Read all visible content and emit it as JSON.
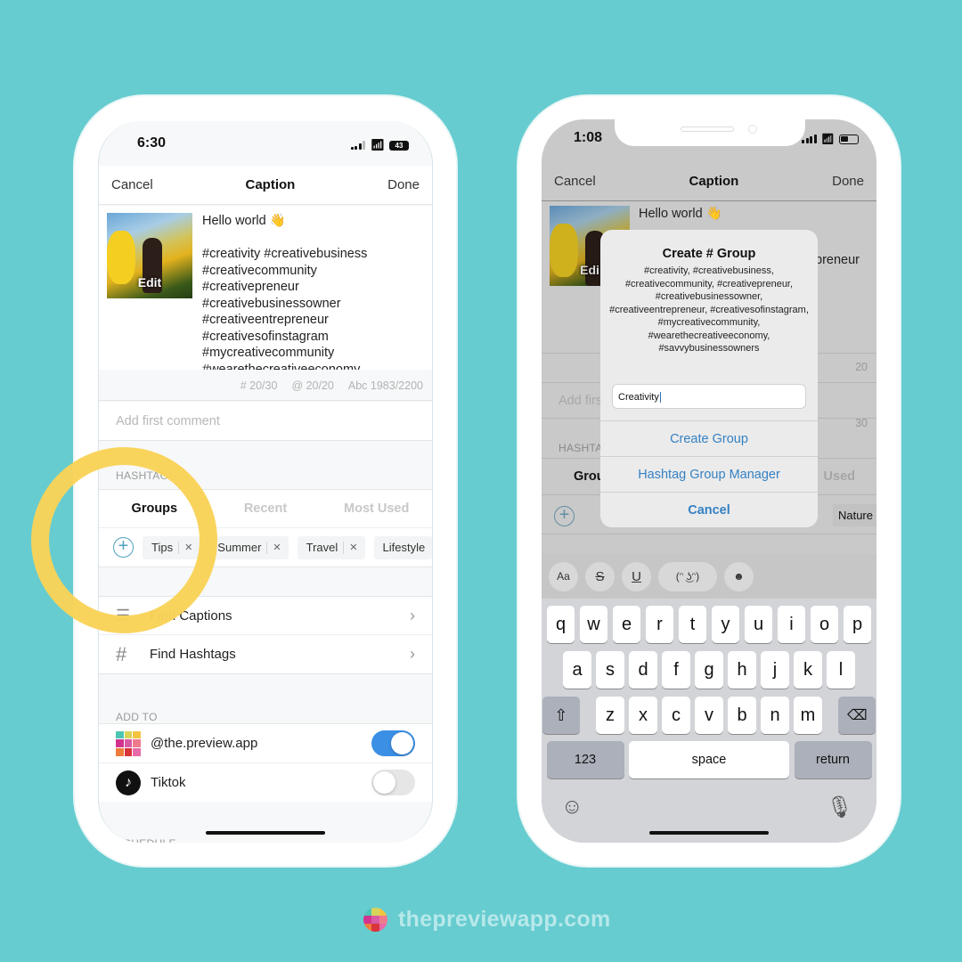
{
  "left_phone": {
    "status": {
      "time": "6:30",
      "battery": "43"
    },
    "nav": {
      "cancel": "Cancel",
      "title": "Caption",
      "done": "Done"
    },
    "post": {
      "thumb_label": "Edit",
      "caption": "Hello world 👋\n\n#creativity #creativebusiness\n#creativecommunity\n#creativepreneur\n#creativebusinessowner\n#creativeentrepreneur\n#creativesofinstagram\n#mycreativecommunity\n#wearethecreativeeconomy"
    },
    "counts": {
      "hashtags": "# 20/30",
      "mentions": "@ 20/20",
      "chars": "Abc 1983/2200"
    },
    "comment_placeholder": "Add first comment",
    "hashtags_section": "HASHTAGS",
    "tabs": [
      {
        "label": "Groups",
        "active": true
      },
      {
        "label": "Recent",
        "active": false
      },
      {
        "label": "Most Used",
        "active": false
      }
    ],
    "chips": [
      "Tips",
      "Summer",
      "Travel",
      "Lifestyle"
    ],
    "menu": [
      {
        "icon": "lines-icon",
        "label": "Find Captions"
      },
      {
        "icon": "hash-icon",
        "label": "Find Hashtags"
      }
    ],
    "add_to_section": "ADD TO",
    "accounts": [
      {
        "label": "@the.preview.app",
        "enabled": true
      },
      {
        "label": "Tiktok",
        "enabled": false
      }
    ],
    "schedule_section": "SCHEDULE"
  },
  "right_phone": {
    "status": {
      "time": "1:08"
    },
    "nav": {
      "cancel": "Cancel",
      "title": "Caption",
      "done": "Done"
    },
    "bg": {
      "caption_first": "Hello world 👋",
      "caption_partial": "preneur",
      "thumb_label": "Edi",
      "count_a": "20",
      "count_b": "30",
      "comment_partial": "Add firs",
      "hashtags_partial": "HASHTA",
      "tab_partial_left": "Grou",
      "tab_partial_right": "Used",
      "chip_partial": "Nature"
    },
    "dialog": {
      "title": "Create # Group",
      "message": "#creativity, #creativebusiness, #creativecommunity, #creativepreneur, #creativebusinessowner, #creativeentrepreneur, #creativesofinstagram, #mycreativecommunity, #wearethecreativeeconomy, #savvybusinessowners",
      "input_value": "Creativity",
      "buttons": [
        "Create Group",
        "Hashtag Group Manager",
        "Cancel"
      ]
    },
    "keyboard": {
      "toolbar": [
        "Aa",
        "S",
        "U",
        "(ᵔ ͜ʖᵔ)",
        "☻"
      ],
      "row1": [
        "q",
        "w",
        "e",
        "r",
        "t",
        "y",
        "u",
        "i",
        "o",
        "p"
      ],
      "row2": [
        "a",
        "s",
        "d",
        "f",
        "g",
        "h",
        "j",
        "k",
        "l"
      ],
      "row3": [
        "z",
        "x",
        "c",
        "v",
        "b",
        "n",
        "m"
      ],
      "numbers": "123",
      "space": "space",
      "return": "return"
    }
  },
  "footer": {
    "text": "thepreviewapp.com"
  },
  "colors": {
    "background": "#66ccd0",
    "highlight_ring": "#f9d358",
    "toggle_on": "#3b8fe4",
    "link_blue": "#3581c4"
  }
}
